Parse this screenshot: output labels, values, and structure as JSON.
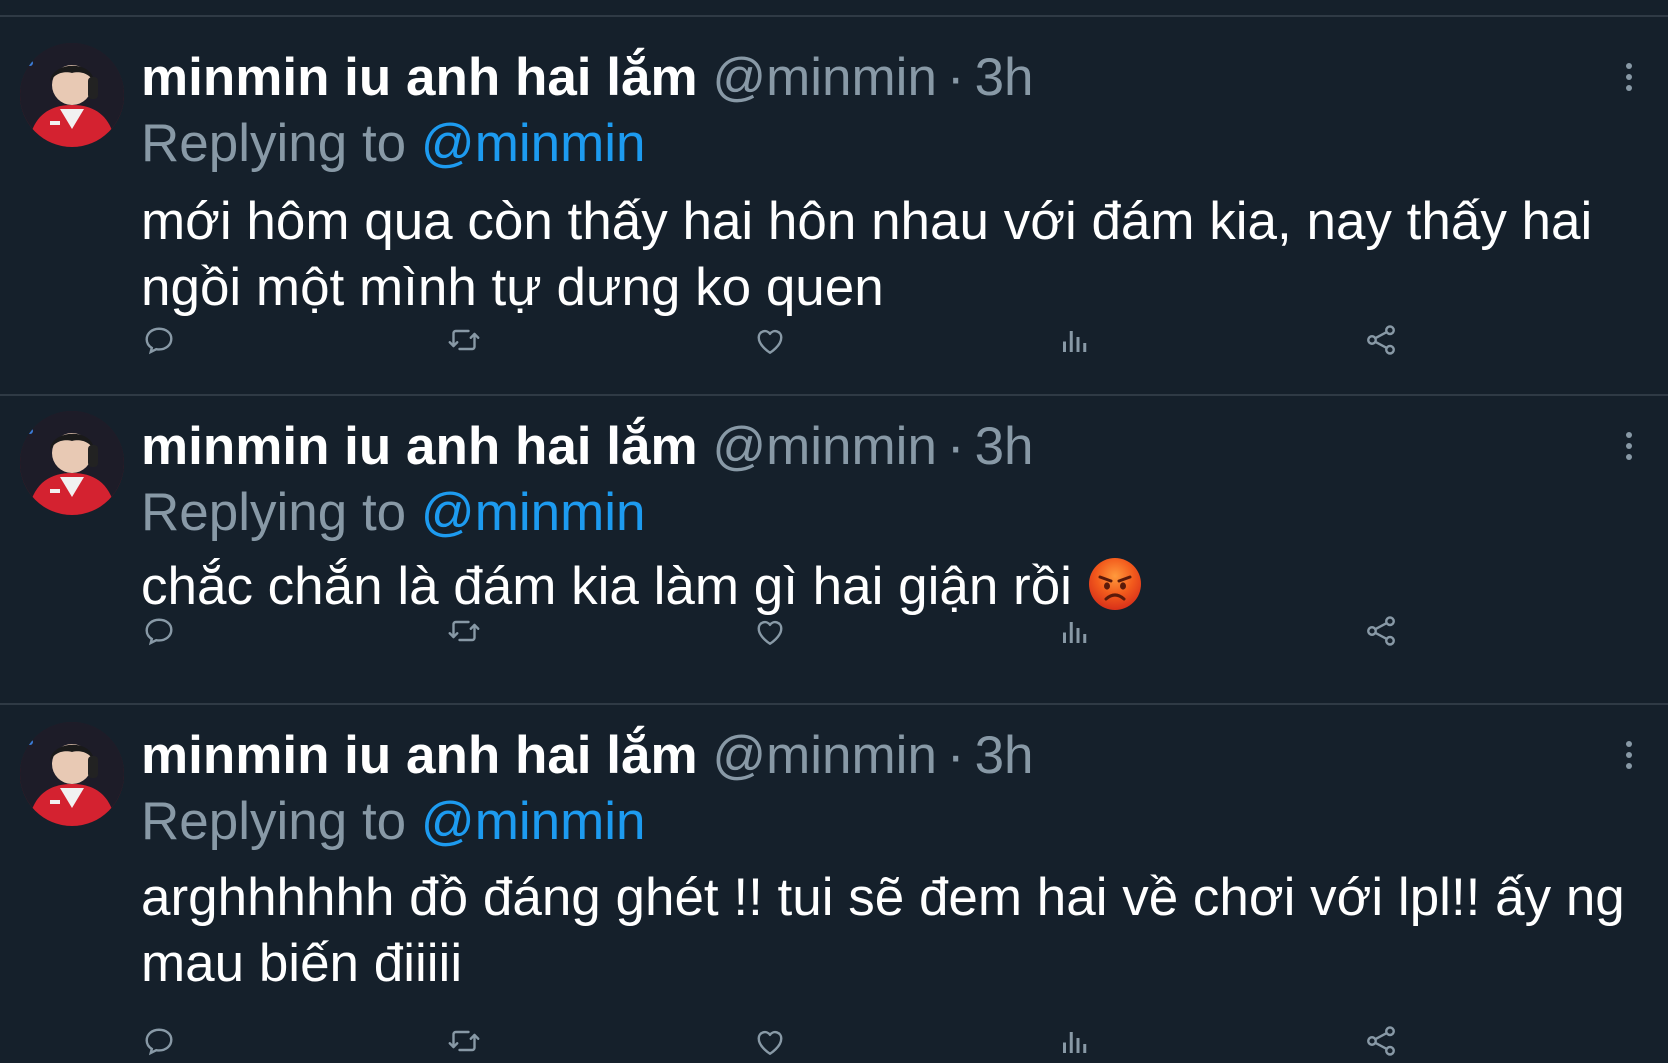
{
  "tweets": [
    {
      "display_name": "minmin iu anh hai lắm",
      "handle": "@minmin",
      "separator": "·",
      "time": "3h",
      "replying_prefix": "Replying to",
      "replying_handle": "@minmin",
      "text": "mới hôm qua còn thấy hai hôn nhau với đám kia, nay thấy hai ngồi một mình tự dưng ko quen"
    },
    {
      "display_name": "minmin iu anh hai lắm",
      "handle": "@minmin",
      "separator": "·",
      "time": "3h",
      "replying_prefix": "Replying to",
      "replying_handle": "@minmin",
      "text": "chắc chắn là đám kia làm gì hai giận rồi",
      "emoji": "angry-face"
    },
    {
      "display_name": "minmin iu anh hai lắm",
      "handle": "@minmin",
      "separator": "·",
      "time": "3h",
      "replying_prefix": "Replying to",
      "replying_handle": "@minmin",
      "text": "arghhhhhh đồ đáng ghét !! tui sẽ đem hai về chơi với lpl!! ấy ng mau biến điiiii"
    }
  ],
  "icons": {
    "reply": "reply-icon",
    "retweet": "retweet-icon",
    "like": "like-icon",
    "views": "views-icon",
    "share": "share-icon",
    "more": "more-icon"
  },
  "colors": {
    "background": "#15202b",
    "primary_text": "#ffffff",
    "secondary_text": "#8899a6",
    "accent": "#1d9bf0",
    "divider": "#2f3a45"
  }
}
